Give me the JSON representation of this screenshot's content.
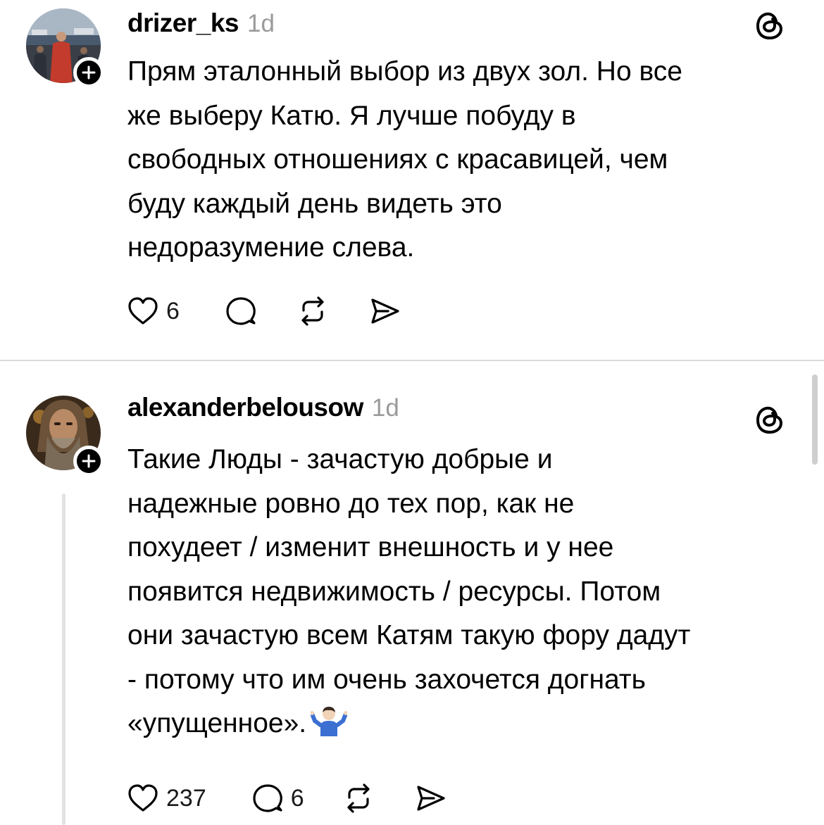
{
  "posts": [
    {
      "username": "drizer_ks",
      "time": "1d",
      "lines": [
        "Прям эталонный выбор из двух зол. Но все",
        "же выберу Катю. Я лучше побуду в",
        "свободных отношениях с красавицей, чем",
        "буду каждый день видеть это",
        "недоразумение слева."
      ],
      "likes": "6",
      "replies": "",
      "icons": {
        "avatar": "avatar-photo",
        "follow": "plus-icon",
        "app": "threads-icon",
        "like": "heart-icon",
        "reply": "comment-icon",
        "repost": "repost-icon",
        "share": "send-icon"
      }
    },
    {
      "username": "alexanderbelousow",
      "time": "1d",
      "lines": [
        "Такие Люды - зачастую добрые и",
        "надежные ровно до тех пор, как не",
        "похудеет / изменит внешность и у нее",
        "появится недвижимость / ресурсы. Потом",
        "они зачастую всем Катям такую фору дадут",
        "- потому что им очень захочется догнать",
        "«упущенное»."
      ],
      "emoji": "person-shrugging-emoji",
      "likes": "237",
      "replies": "6",
      "icons": {
        "avatar": "avatar-photo",
        "follow": "plus-icon",
        "app": "threads-icon",
        "like": "heart-icon",
        "reply": "comment-icon",
        "repost": "repost-icon",
        "share": "send-icon"
      }
    }
  ],
  "colors": {
    "text": "#000000",
    "muted": "#9a9a9a",
    "divider": "#d9d9d9",
    "thread_line": "#e2e2e2"
  }
}
